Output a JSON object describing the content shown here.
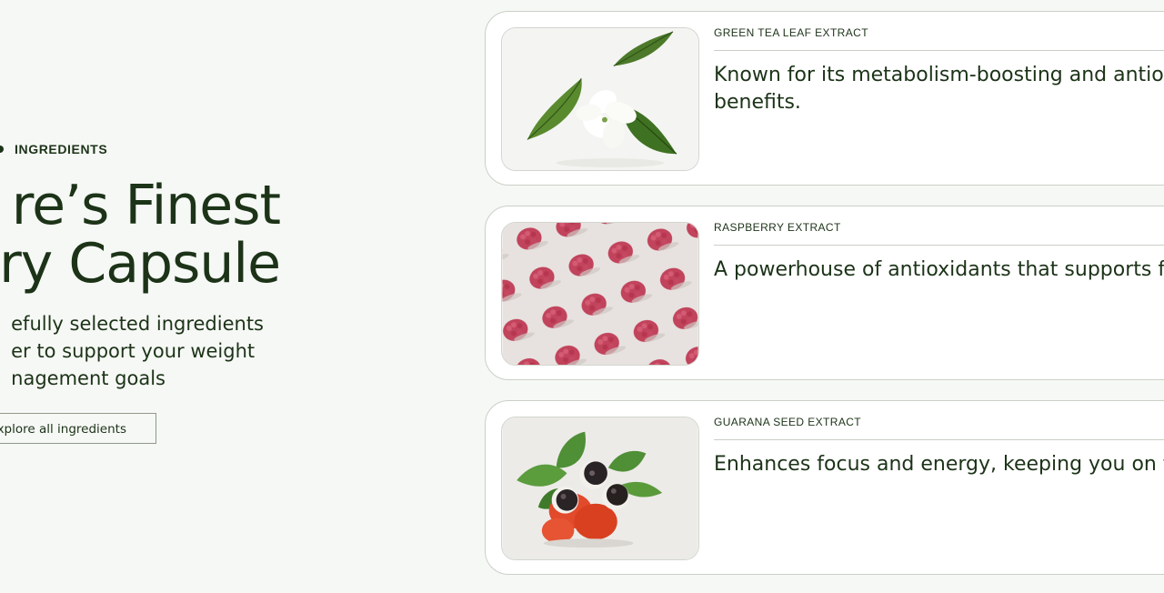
{
  "intro": {
    "eyebrow": "INGREDIENTS",
    "headline_line1": "re’s Finest",
    "headline_line2": "ry Capsule",
    "subtext_line1": "efully selected ingredients",
    "subtext_line2": "er to support your weight",
    "subtext_line3": "nagement goals",
    "button_label": "xplore all ingredients"
  },
  "ingredients": [
    {
      "label": "GREEN TEA LEAF EXTRACT",
      "description": "Known for its metabolism-boosting and antio benefits.",
      "icon": "green-tea-leaf-image"
    },
    {
      "label": "RASPBERRY EXTRACT",
      "description": "A powerhouse of antioxidants that supports f",
      "icon": "raspberry-image"
    },
    {
      "label": "GUARANA SEED EXTRACT",
      "description": "Enhances focus and energy, keeping you on t",
      "icon": "guarana-seed-image"
    }
  ],
  "colors": {
    "background": "#f6f8f5",
    "text": "#1c3318",
    "card": "#ffffff",
    "border": "#c9d0c6"
  }
}
